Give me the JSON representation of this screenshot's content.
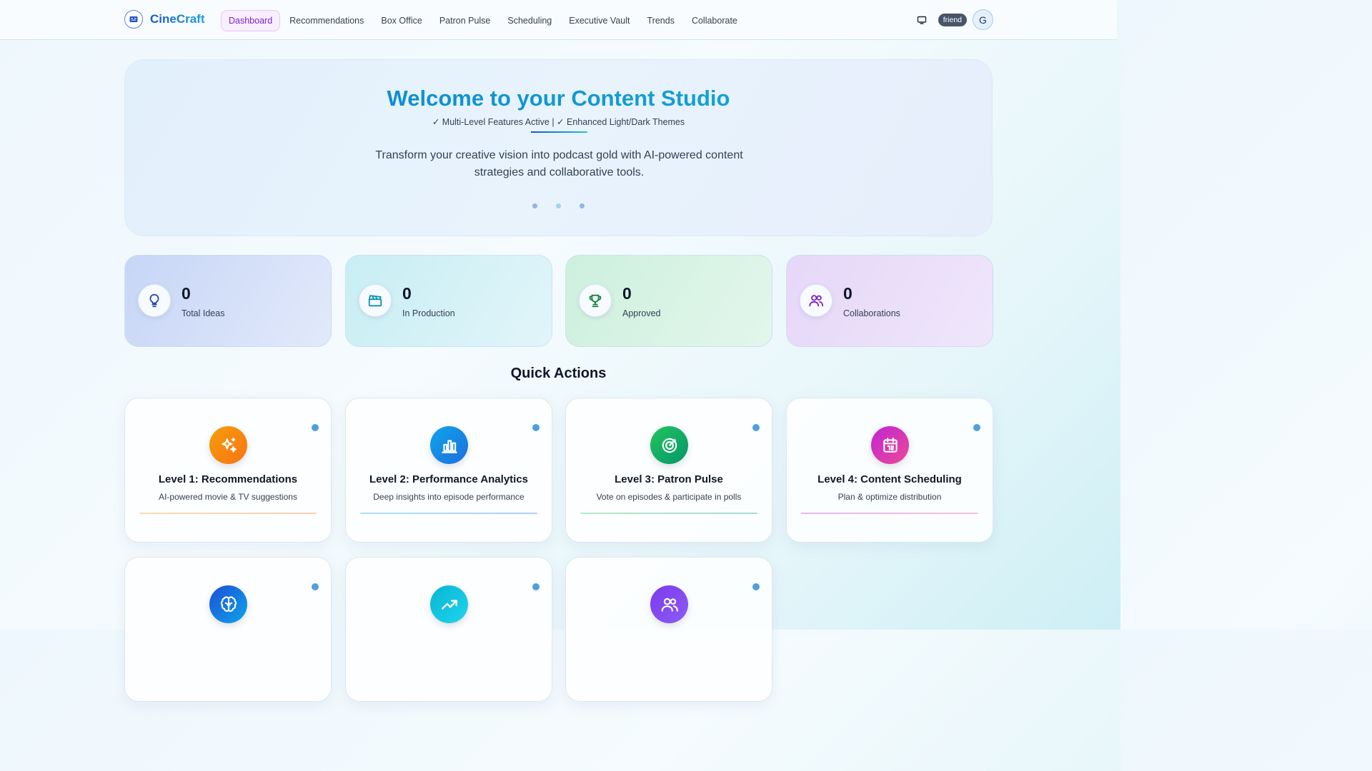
{
  "header": {
    "logo_text": "CineCraft",
    "logo_icon": "film-strip-icon",
    "nav": [
      {
        "label": "Dashboard",
        "active": true
      },
      {
        "label": "Recommendations",
        "active": false
      },
      {
        "label": "Box Office",
        "active": false
      },
      {
        "label": "Patron Pulse",
        "active": false
      },
      {
        "label": "Scheduling",
        "active": false
      },
      {
        "label": "Executive Vault",
        "active": false
      },
      {
        "label": "Trends",
        "active": false
      },
      {
        "label": "Collaborate",
        "active": false
      }
    ],
    "theme_icon": "monitor-icon",
    "user_badge": "friend",
    "avatar_letter": "G"
  },
  "hero": {
    "title": "Welcome to your Content Studio",
    "subtitle": "✓ Multi-Level Features Active | ✓ Enhanced Light/Dark Themes",
    "description": "Transform your creative vision into podcast gold with AI-powered content strategies and collaborative tools.",
    "dot_colors": [
      "#93b4e4",
      "#9ad7ec",
      "#93b4e4"
    ]
  },
  "stats": [
    {
      "value": "0",
      "label": "Total Ideas",
      "icon": "lightbulb-icon",
      "color": "#1e40af"
    },
    {
      "value": "0",
      "label": "In Production",
      "icon": "clapperboard-icon",
      "color": "#0891b2"
    },
    {
      "value": "0",
      "label": "Approved",
      "icon": "trophy-icon",
      "color": "#15803d"
    },
    {
      "value": "0",
      "label": "Collaborations",
      "icon": "users-icon",
      "color": "#7e22ce"
    }
  ],
  "quick_actions": {
    "title": "Quick Actions",
    "cards": [
      {
        "title": "Level 1: Recommendations",
        "description": "AI-powered movie & TV suggestions",
        "icon": "sparkles-icon",
        "colors": [
          "#f59e0b",
          "#f97316"
        ]
      },
      {
        "title": "Level 2: Performance Analytics",
        "description": "Deep insights into episode performance",
        "icon": "bar-chart-icon",
        "colors": [
          "#0ea5e9",
          "#1d6fe0"
        ]
      },
      {
        "title": "Level 3: Patron Pulse",
        "description": "Vote on episodes & participate in polls",
        "icon": "target-icon",
        "colors": [
          "#22c55e",
          "#059669"
        ]
      },
      {
        "title": "Level 4: Content Scheduling",
        "description": "Plan & optimize distribution",
        "icon": "calendar-icon",
        "colors": [
          "#c026d3",
          "#ec4899"
        ]
      },
      {
        "title": "",
        "description": "",
        "icon": "brain-icon",
        "colors": [
          "#1d4ed8",
          "#0ea5e9"
        ]
      },
      {
        "title": "",
        "description": "",
        "icon": "trending-up-icon",
        "colors": [
          "#06b6d4",
          "#22d3ee"
        ]
      },
      {
        "title": "",
        "description": "",
        "icon": "users-icon",
        "colors": [
          "#7c3aed",
          "#8b5cf6"
        ]
      }
    ]
  }
}
